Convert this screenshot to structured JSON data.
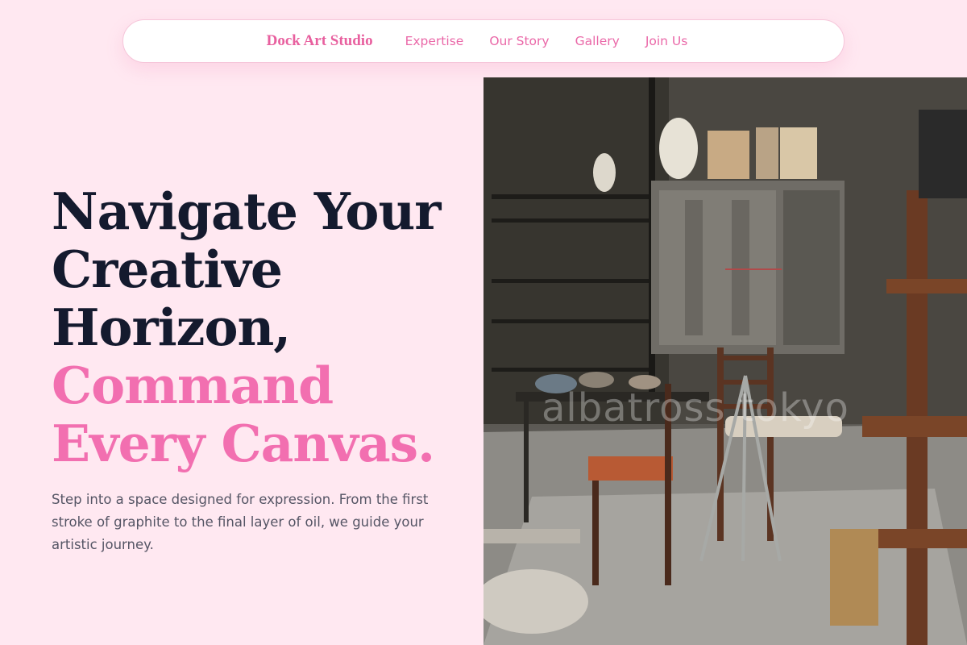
{
  "nav": {
    "brand": "Dock Art Studio",
    "links": [
      "Expertise",
      "Our Story",
      "Gallery",
      "Join Us"
    ]
  },
  "hero": {
    "title_lines": [
      "Navigate Your",
      "Creative",
      "Horizon,"
    ],
    "accent_lines": [
      "Command",
      "Every Canvas."
    ],
    "subtitle": "Step into a space designed for expression. From the first stroke of graphite to the final layer of oil, we guide your artistic journey."
  },
  "image": {
    "watermark": "albatross tokyo"
  },
  "colors": {
    "background": "#ffe8f1",
    "accent": "#f26fb0",
    "heading": "#141a2e",
    "body_text": "#555565"
  }
}
